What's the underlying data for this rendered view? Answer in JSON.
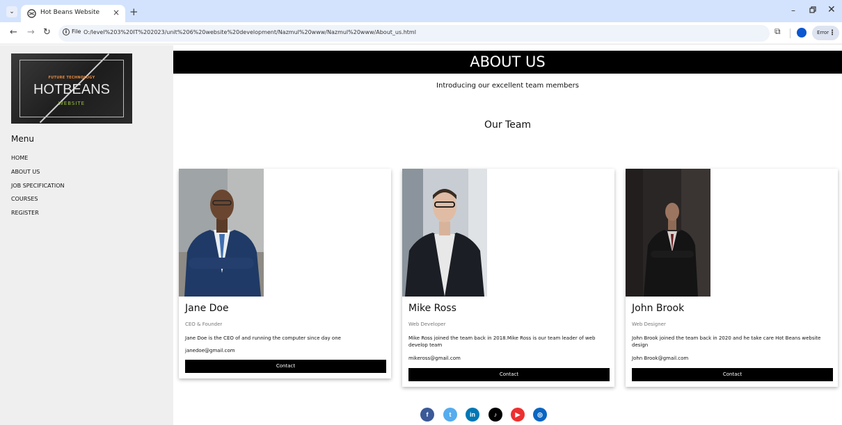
{
  "browser": {
    "tab_title": "Hot Beans Website",
    "tab_close": "×",
    "new_tab": "+",
    "url_chip": "File",
    "url": "O:/level%203%20IT%202023/unit%206%20website%20development/Nazmul%20www/Nazmul%20www/About_us.html",
    "profile_status": "Error",
    "icons": [
      "tab-menu-icon",
      "site-icon",
      "back-icon",
      "forward-icon",
      "reload-icon",
      "info-icon",
      "zoom-icon",
      "star-icon",
      "extensions-icon",
      "profile-icon",
      "more-icon",
      "minimize-icon",
      "maximize-icon",
      "close-icon"
    ]
  },
  "logo": {
    "tagline": "FUTURE TECHNOLOGY",
    "main": "HOTBEANS",
    "sub": "WEBSITE"
  },
  "sidebar": {
    "title": "Menu",
    "items": [
      {
        "label": "HOME"
      },
      {
        "label": "ABOUT US"
      },
      {
        "label": "JOB SPECIFICATION"
      },
      {
        "label": "COURSES"
      },
      {
        "label": "REGISTER"
      }
    ]
  },
  "page": {
    "banner": "ABOUT US",
    "intro": "Introducing our excellent team members",
    "team_title": "Our Team"
  },
  "team": [
    {
      "name": "Jane Doe",
      "role": "CEO & Founder",
      "description": "Jane Doe is the CEO of and running the computer since day one",
      "email": "janedoe@gmail.com",
      "button": "Contact"
    },
    {
      "name": "Mike Ross",
      "role": "Web Developer",
      "description": "Mike Ross joined the team back in 2018.Mike Ross is our team leader of web develop team",
      "email": "mikeross@gmail.com",
      "button": "Contact"
    },
    {
      "name": "John Brook",
      "role": "Web Designer",
      "description": "John Brook joined the team back in 2020 and he take care Hot Beans website design",
      "email": "John Brook@gmail.com",
      "button": "Contact"
    }
  ],
  "socials": [
    {
      "name": "facebook-icon",
      "glyph": "f",
      "color": "#3b5998"
    },
    {
      "name": "twitter-icon",
      "glyph": "t",
      "color": "#55acee"
    },
    {
      "name": "linkedin-icon",
      "glyph": "in",
      "color": "#0077b5"
    },
    {
      "name": "tiktok-icon",
      "glyph": "♪",
      "color": "#000000"
    },
    {
      "name": "youtube-icon",
      "glyph": "▶",
      "color": "#ed302f"
    },
    {
      "name": "instagram-icon",
      "glyph": "◎",
      "color": "#0a66c2"
    }
  ],
  "colors": {
    "tabbar": "#d3e3fd",
    "sidebar": "#efefef",
    "banner": "#000000",
    "logo_accent": "#9bc33f"
  }
}
